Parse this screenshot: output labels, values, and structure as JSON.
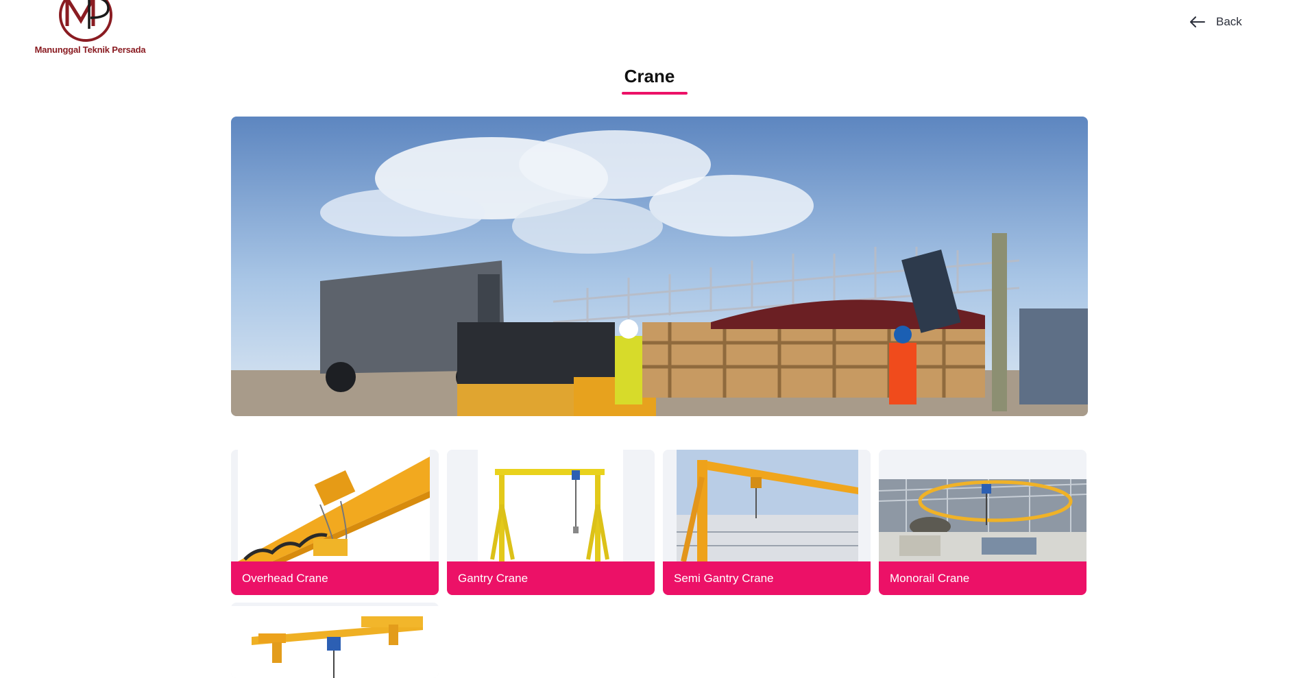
{
  "header": {
    "company_name": "Manunggal Teknik Persada",
    "logo_letters": "MP",
    "back_label": "Back"
  },
  "page": {
    "title": "Crane"
  },
  "colors": {
    "accent": "#ec1167",
    "logo_red": "#8a1c22"
  },
  "products": [
    {
      "label": "Overhead Crane",
      "icon": "overhead-crane-photo"
    },
    {
      "label": "Gantry Crane",
      "icon": "gantry-crane-photo"
    },
    {
      "label": "Semi Gantry Crane",
      "icon": "semi-gantry-crane-photo"
    },
    {
      "label": "Monorail Crane",
      "icon": "monorail-crane-photo"
    },
    {
      "label": "",
      "icon": "suspension-crane-photo"
    }
  ]
}
